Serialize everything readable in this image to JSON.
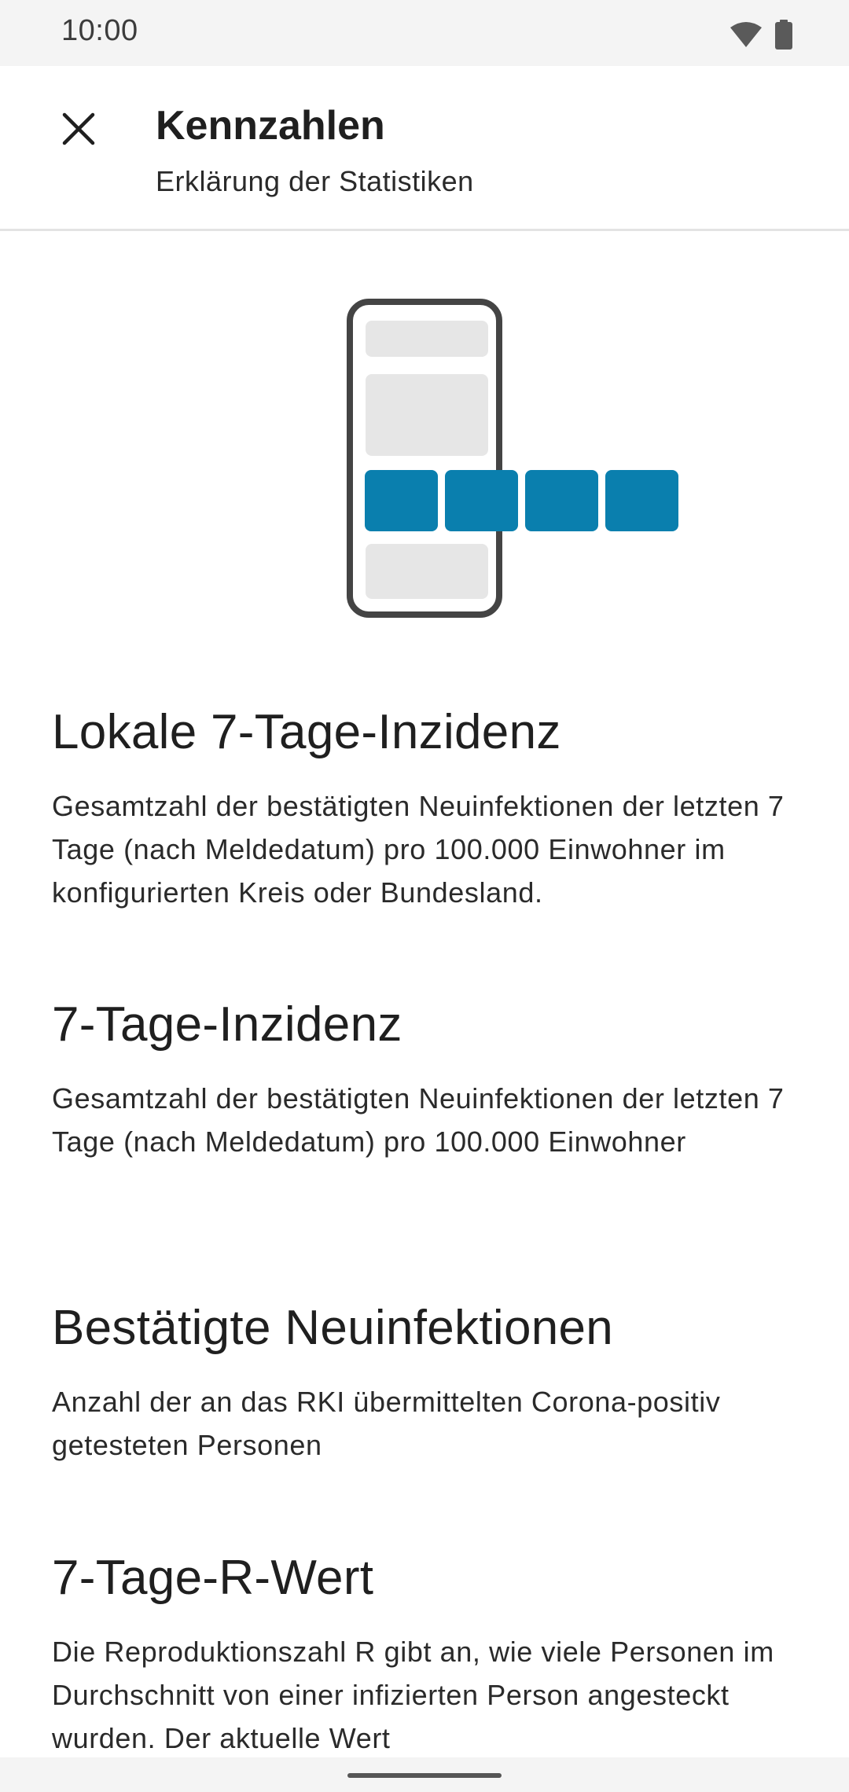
{
  "status_bar": {
    "time": "10:00"
  },
  "app_bar": {
    "title": "Kennzahlen",
    "subtitle": "Erklärung der Statistiken"
  },
  "colors": {
    "accent_blue": "#0a7fae",
    "placeholder_gray": "#e6e6e6",
    "phone_outline": "#444444"
  },
  "sections": [
    {
      "heading": "Lokale 7-Tage-Inzidenz",
      "body": "Gesamtzahl der bestätigten Neuinfektionen der letzten 7 Tage (nach Meldedatum) pro 100.000 Einwohner im konfigurierten Kreis oder Bundesland."
    },
    {
      "heading": "7-Tage-Inzidenz",
      "body": "Gesamtzahl der bestätigten Neuinfektionen der letzten 7 Tage (nach Meldedatum) pro 100.000 Einwohner"
    },
    {
      "heading": "Bestätigte Neuinfektionen",
      "body": "Anzahl der an das RKI übermittelten Corona-positiv getesteten Personen"
    },
    {
      "heading": "7-Tage-R-Wert",
      "body": "Die Reproduktionszahl R gibt an, wie viele Personen im Durchschnitt von einer infizierten Person angesteckt wurden. Der aktuelle Wert"
    }
  ]
}
